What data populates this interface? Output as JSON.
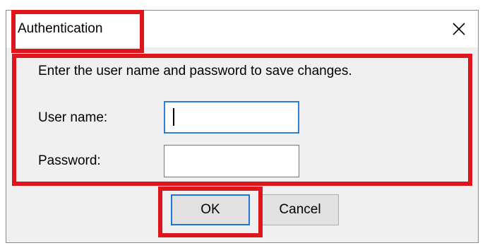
{
  "window": {
    "title": "Authentication",
    "close_icon": "close-icon"
  },
  "form": {
    "prompt": "Enter the user name and password to save changes.",
    "username_label": "User name:",
    "username_value": "",
    "password_label": "Password:",
    "password_value": ""
  },
  "buttons": {
    "ok_label": "OK",
    "cancel_label": "Cancel"
  },
  "colors": {
    "highlight": "#e0141b",
    "focus_border": "#2f7fd0",
    "dialog_bg": "#f0f0f0"
  }
}
